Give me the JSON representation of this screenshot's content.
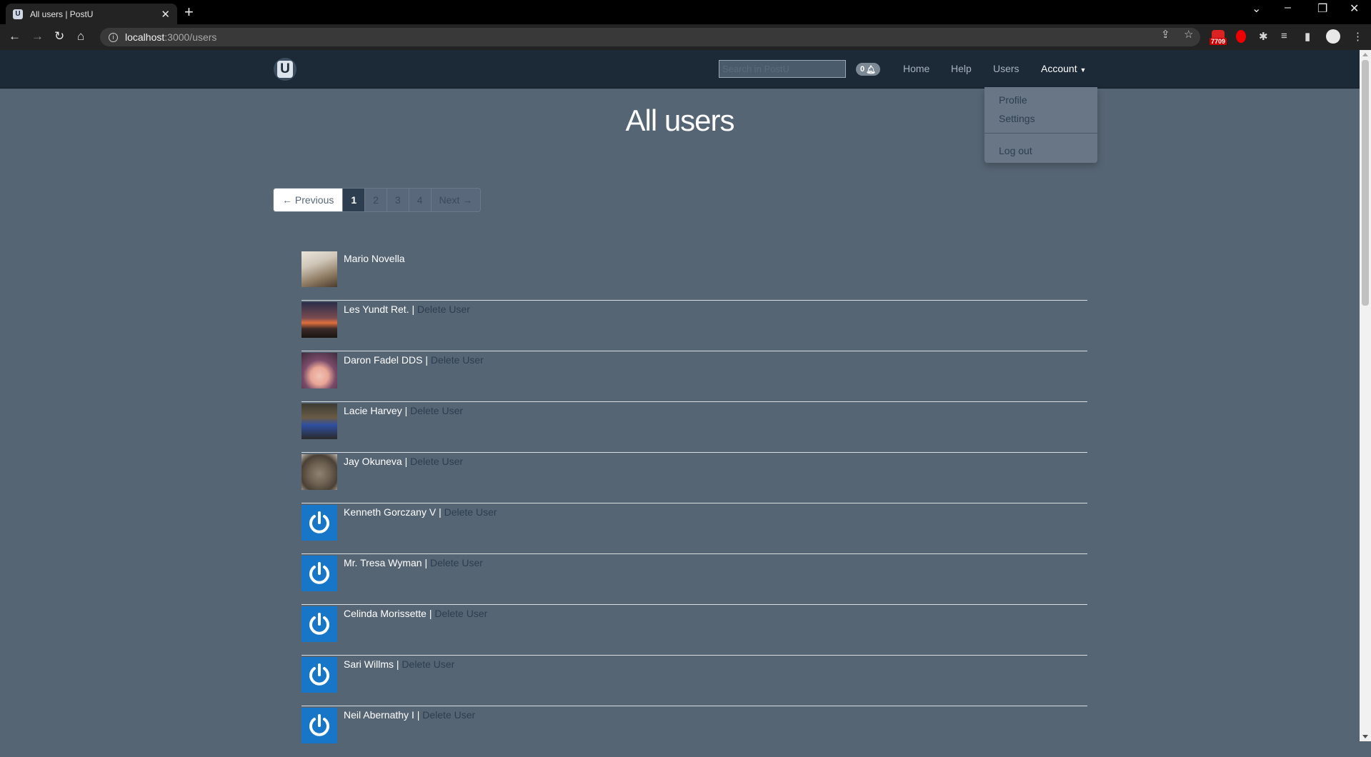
{
  "browser": {
    "tab_title": "All users | PostU",
    "favicon_letter": "U",
    "url_host": "localhost",
    "url_path": ":3000/users",
    "extension_badge": "7709"
  },
  "site": {
    "logo_letter": "U",
    "search_placeholder": "Search in PostU",
    "notification_count": "0",
    "nav": {
      "home": "Home",
      "help": "Help",
      "users": "Users",
      "account": "Account"
    },
    "account_menu": {
      "profile": "Profile",
      "settings": "Settings",
      "logout": "Log out"
    }
  },
  "main": {
    "title": "All users",
    "pagination": {
      "previous": "← Previous",
      "pages": [
        "1",
        "2",
        "3",
        "4"
      ],
      "current": "1",
      "next": "Next →"
    },
    "users": [
      {
        "name": "Mario Novella",
        "separator": "",
        "delete_label": "",
        "avatar": "photo"
      },
      {
        "name": "Les Yundt Ret.",
        "separator": " | ",
        "delete_label": "Delete User",
        "avatar": "photo"
      },
      {
        "name": "Daron Fadel DDS",
        "separator": " | ",
        "delete_label": "Delete User",
        "avatar": "photo"
      },
      {
        "name": "Lacie Harvey",
        "separator": " | ",
        "delete_label": "Delete User",
        "avatar": "photo"
      },
      {
        "name": "Jay Okuneva",
        "separator": " | ",
        "delete_label": "Delete User",
        "avatar": "photo"
      },
      {
        "name": "Kenneth Gorczany V",
        "separator": " | ",
        "delete_label": "Delete User",
        "avatar": "power-icon"
      },
      {
        "name": "Mr. Tresa Wyman",
        "separator": " | ",
        "delete_label": "Delete User",
        "avatar": "power-icon"
      },
      {
        "name": "Celinda Morissette",
        "separator": " | ",
        "delete_label": "Delete User",
        "avatar": "power-icon"
      },
      {
        "name": "Sari Willms",
        "separator": " | ",
        "delete_label": "Delete User",
        "avatar": "power-icon"
      },
      {
        "name": "Neil Abernathy I",
        "separator": " | ",
        "delete_label": "Delete User",
        "avatar": "power-icon"
      }
    ]
  },
  "colors": {
    "page_bg": "#566574",
    "navbar_bg": "#1c2a38",
    "avatar_blue": "#1876c8",
    "pagination_active": "#2c3e50"
  }
}
